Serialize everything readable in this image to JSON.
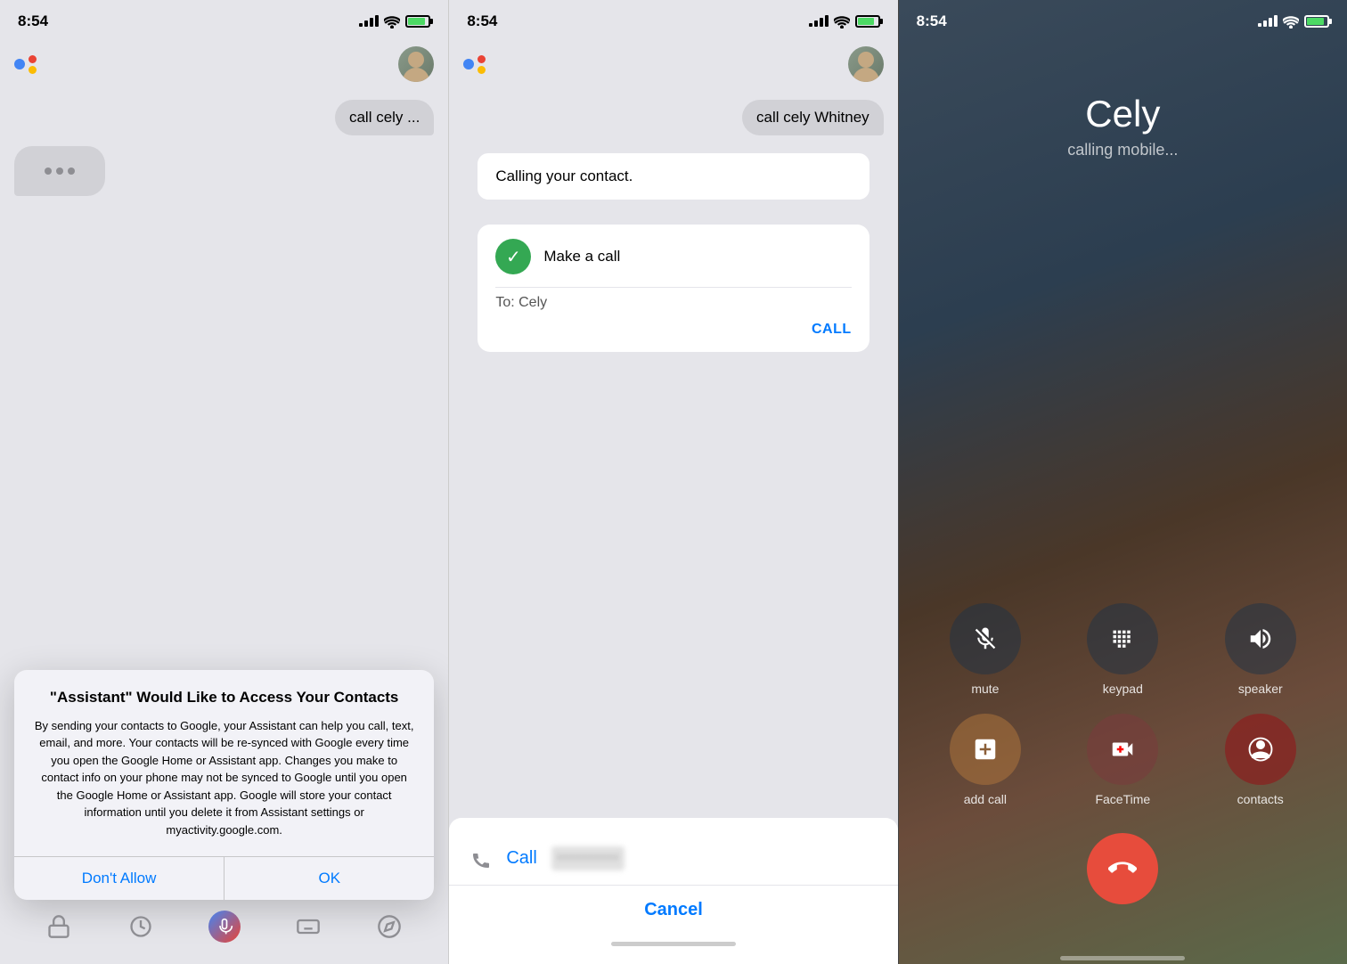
{
  "panels": {
    "panel1": {
      "status": {
        "time": "8:54",
        "signal": [
          2,
          3,
          4,
          5
        ],
        "wifi": true,
        "battery_pct": 90
      },
      "user_bubble": "call cely ...",
      "typing": true,
      "dialog": {
        "title": "\"Assistant\" Would Like to Access Your Contacts",
        "body": "By sending your contacts to Google, your Assistant can help you call, text, email, and more. Your contacts will be re-synced with Google every time you open the Google Home or Assistant app. Changes you make to contact info on your phone may not be synced to Google until you open the Google Home or Assistant app. Google will store your contact information until you delete it from Assistant settings or myactivity.google.com.",
        "btn_deny": "Don't Allow",
        "btn_allow": "OK"
      }
    },
    "panel2": {
      "status": {
        "time": "8:54",
        "signal": [
          2,
          3,
          4,
          5
        ],
        "wifi": true,
        "battery_pct": 90
      },
      "user_bubble": "call cely Whitney",
      "calling_text": "Calling your contact.",
      "make_call_card": {
        "title": "Make a call",
        "to_label": "To: Cely",
        "call_button": "CALL"
      },
      "action_sheet": {
        "call_label": "Call",
        "blurred_number": "••••••••••••",
        "cancel_label": "Cancel"
      }
    },
    "panel3": {
      "status": {
        "time": "8:54",
        "signal": [
          2,
          3,
          4,
          5
        ],
        "wifi": true,
        "battery_pct": 90
      },
      "contact_name": "Cely",
      "call_status": "calling mobile...",
      "buttons": [
        {
          "id": "mute",
          "label": "mute",
          "icon": "mute-icon"
        },
        {
          "id": "keypad",
          "label": "keypad",
          "icon": "keypad-icon"
        },
        {
          "id": "speaker",
          "label": "speaker",
          "icon": "speaker-icon"
        },
        {
          "id": "add-call",
          "label": "add call",
          "icon": "add-icon"
        },
        {
          "id": "facetime",
          "label": "FaceTime",
          "icon": "facetime-icon"
        },
        {
          "id": "contacts",
          "label": "contacts",
          "icon": "contacts-icon"
        }
      ],
      "end_call_label": "end"
    }
  }
}
